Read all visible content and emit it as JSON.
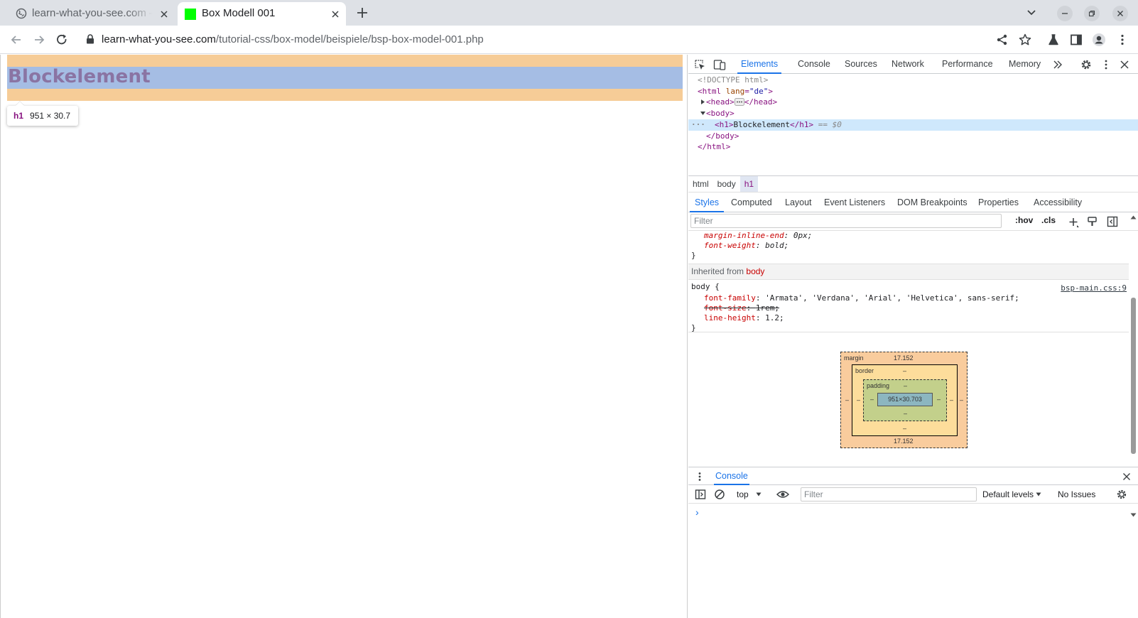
{
  "browser": {
    "tabs": [
      {
        "title": "learn-what-you-see.com – ",
        "active": false
      },
      {
        "title": "Box Modell 001",
        "active": true
      }
    ],
    "url_host": "learn-what-you-see.com",
    "url_path": "/tutorial-css/box-model/beispiele/bsp-box-model-001.php"
  },
  "page": {
    "heading": "Blockelement",
    "tooltip_tag": "h1",
    "tooltip_dims": "951 × 30.7"
  },
  "devtools": {
    "tabs": [
      "Elements",
      "Console",
      "Sources",
      "Network",
      "Performance",
      "Memory"
    ],
    "active_tab": "Elements",
    "dom": {
      "doctype": "<!DOCTYPE html>",
      "html_open_tag": "<html",
      "html_attr": "lang",
      "html_attr_val": "\"de\"",
      "html_close_bracket": ">",
      "head_open": "<head>",
      "head_close": "</head>",
      "body_open": "<body>",
      "h1_open": "<h1>",
      "h1_text": "Blockelement",
      "h1_close": "</h1>",
      "selected_marker": "== $0",
      "body_close": "</body>",
      "html_close": "</html>"
    },
    "breadcrumbs": [
      "html",
      "body",
      "h1"
    ],
    "subtabs": [
      "Styles",
      "Computed",
      "Layout",
      "Event Listeners",
      "DOM Breakpoints",
      "Properties",
      "Accessibility"
    ],
    "styles": {
      "filter_placeholder": "Filter",
      "hov": ":hov",
      "cls": ".cls",
      "rule1": [
        {
          "prop": "margin-inline-end",
          "val": "0px;"
        },
        {
          "prop": "font-weight",
          "val": "bold;"
        }
      ],
      "close_brace": "}",
      "inherited_label": "Inherited from",
      "inherited_from": "body",
      "body_selector": "body {",
      "source_link": "bsp-main.css:9",
      "body_rules": [
        {
          "prop": "font-family",
          "val": "'Armata', 'Verdana', 'Arial', 'Helvetica', sans-serif;",
          "struck": false
        },
        {
          "prop": "font-size",
          "val": "1rem;",
          "struck": true
        },
        {
          "prop": "line-height",
          "val": "1.2;",
          "struck": false
        }
      ]
    },
    "box_model": {
      "margin_label": "margin",
      "margin_top": "17.152",
      "margin_bottom": "17.152",
      "margin_side": "–",
      "border_label": "border",
      "border_value": "–",
      "padding_label": "padding",
      "padding_value": "–",
      "content": "951×30.703"
    },
    "console": {
      "tab": "Console",
      "context": "top",
      "filter_placeholder": "Filter",
      "levels": "Default levels",
      "issues": "No Issues",
      "prompt": "›"
    }
  },
  "colors": {
    "margin_highlight": "#f6cc97",
    "content_highlight": "#a5bde4",
    "heading_text": "#8a74a3",
    "accent": "#1a73e8",
    "favicon": "#00ff00"
  }
}
